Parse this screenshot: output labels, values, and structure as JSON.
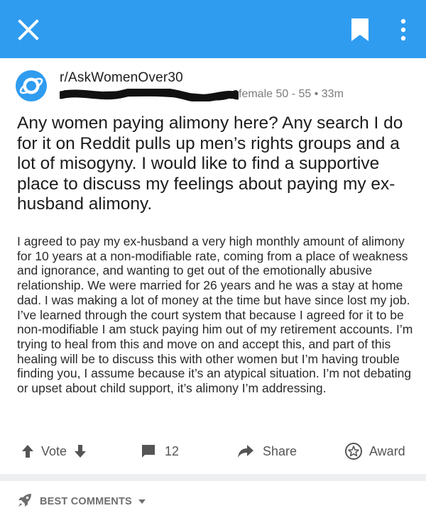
{
  "topbar": {
    "color": "#2f9cf0",
    "icons": [
      "close-icon",
      "bookmark-icon",
      "more-vertical-icon"
    ]
  },
  "post": {
    "subreddit": "r/AskWomenOver30",
    "meta": "female 50 - 55 • 33m",
    "title": "Any women paying alimony here? Any search I do for it on Reddit pulls up men’s rights groups and a lot of misogyny. I would like to find a supportive place to discuss my feelings about paying my ex-husband alimony.",
    "body": "I agreed to pay my ex-husband a very high monthly amount of alimony for 10 years at a non-modifiable rate, coming from a place of weakness and ignorance, and wanting to get out of the emotionally abusive relationship. We were married for 26 years and he was a stay at home dad. I was making a lot of money at the time but have since lost my job. I’ve learned through the court system that because I agreed for it to be non-modifiable I am stuck paying him out of my retirement accounts. I’m trying to heal from this and move on and accept this, and part of this healing will be to discuss this with other women but I’m having trouble finding you, I assume because it’s an atypical situation. I’m not debating or upset about child support, it’s alimony I’m addressing."
  },
  "actions": {
    "vote_label": "Vote",
    "comments_count": "12",
    "share_label": "Share",
    "award_label": "Award"
  },
  "comments_sort": {
    "label": "BEST COMMENTS"
  }
}
